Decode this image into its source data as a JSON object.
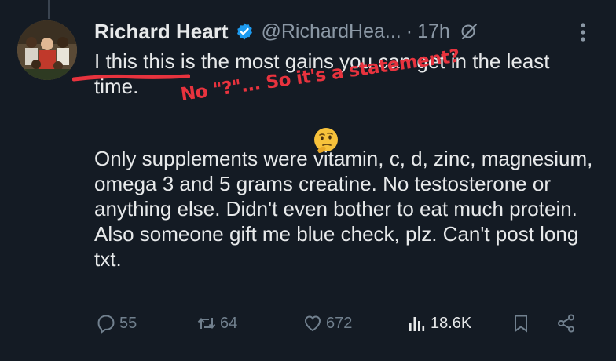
{
  "tweet": {
    "author_name": "Richard Heart",
    "handle": "@RichardHea...",
    "separator": "·",
    "time": "17h",
    "text_line1": "I this this is the most gains you can get in the least time.",
    "text_line2": "Only supplements were vitamin, c, d, zinc, magnesium, omega 3 and 5 grams creatine. No testosterone or anything else. Didn't even bother to eat much protein. Also someone gift me blue check, plz. Can't post long txt."
  },
  "annotation": {
    "text": "No \"?\"... So it's a statement?",
    "color": "#e8333e"
  },
  "actions": {
    "replies": "55",
    "reposts": "64",
    "likes": "672",
    "views": "18.6K"
  },
  "colors": {
    "background": "#141b24",
    "text": "#e7e9ea",
    "muted": "#71808e",
    "verified": "#1d9bf0"
  },
  "icons": [
    "verified-badge-icon",
    "grok-icon",
    "more-icon",
    "reply-icon",
    "repost-icon",
    "like-icon",
    "views-icon",
    "bookmark-icon",
    "share-icon",
    "thinking-face-emoji"
  ]
}
